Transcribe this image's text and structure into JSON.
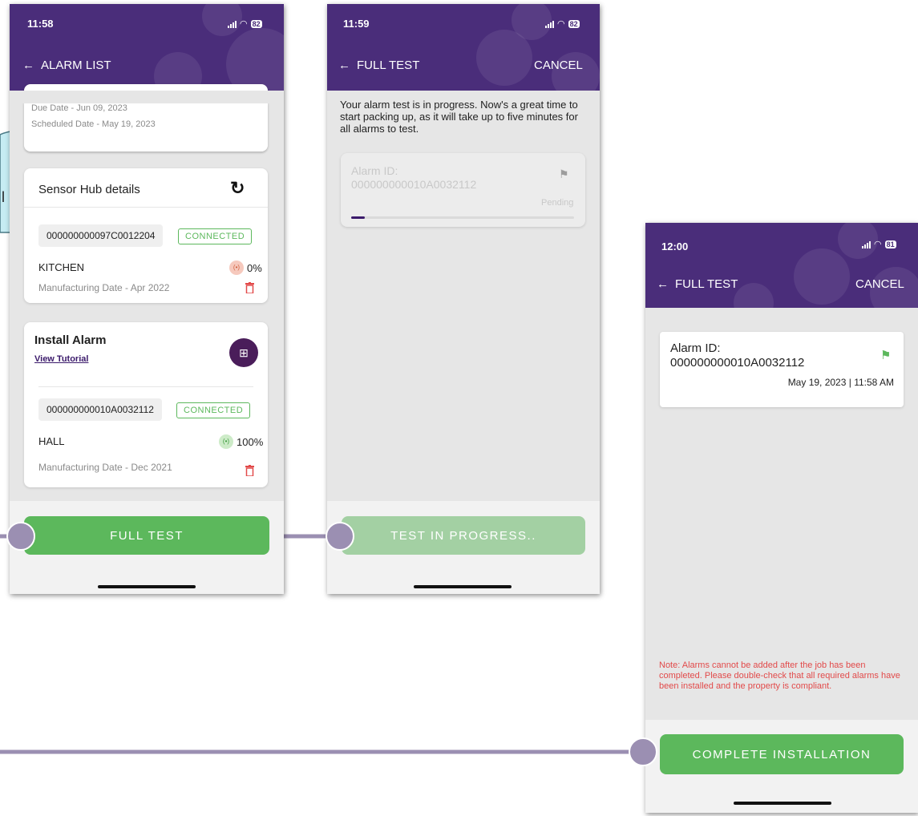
{
  "colors": {
    "header": "#4a2d7a",
    "green": "#5cb85c",
    "green_faded": "#a3d0a3",
    "connector": "#9b8fb2",
    "danger": "#e24a4a"
  },
  "screen1": {
    "status": {
      "time": "11:58",
      "battery": "82"
    },
    "nav": {
      "back_icon": "arrow-left-icon",
      "title": "ALARM LIST"
    },
    "schedule": {
      "due_date": "Due Date - Jun 09, 2023",
      "scheduled_date": "Scheduled Date - May 19, 2023"
    },
    "hub": {
      "title": "Sensor Hub details",
      "refresh_icon": "refresh-icon",
      "id": "000000000097C0012204",
      "status": "CONNECTED",
      "location": "KITCHEN",
      "battery": "0%",
      "mfg": "Manufacturing Date - Apr 2022"
    },
    "install": {
      "title": "Install Alarm",
      "tutorial": "View Tutorial",
      "qr_icon": "qr-scan-icon",
      "id": "000000000010A0032112",
      "status": "CONNECTED",
      "location": "HALL",
      "battery": "100%",
      "mfg": "Manufacturing Date - Dec 2021"
    },
    "button": "FULL TEST",
    "edge_letter": "l"
  },
  "screen2": {
    "status": {
      "time": "11:59",
      "battery": "82"
    },
    "nav": {
      "title": "FULL TEST",
      "cancel": "CANCEL"
    },
    "message": "Your alarm test is in progress. Now's a great time to start packing up, as it will take up to five minutes for all alarms to test.",
    "alarm": {
      "label": "Alarm ID:",
      "id": "000000000010A0032112",
      "status": "Pending",
      "progress": 0.06
    },
    "button": "TEST IN PROGRESS.."
  },
  "screen3": {
    "status": {
      "time": "12:00",
      "battery": "81"
    },
    "nav": {
      "title": "FULL TEST",
      "cancel": "CANCEL"
    },
    "alarm": {
      "label": "Alarm ID:",
      "id": "000000000010A0032112",
      "timestamp": "May 19, 2023 | 11:58 AM"
    },
    "note": "Note: Alarms cannot be added after the job has been completed. Please double-check that all required alarms have been installed and the property is compliant.",
    "button": "COMPLETE INSTALLATION"
  }
}
